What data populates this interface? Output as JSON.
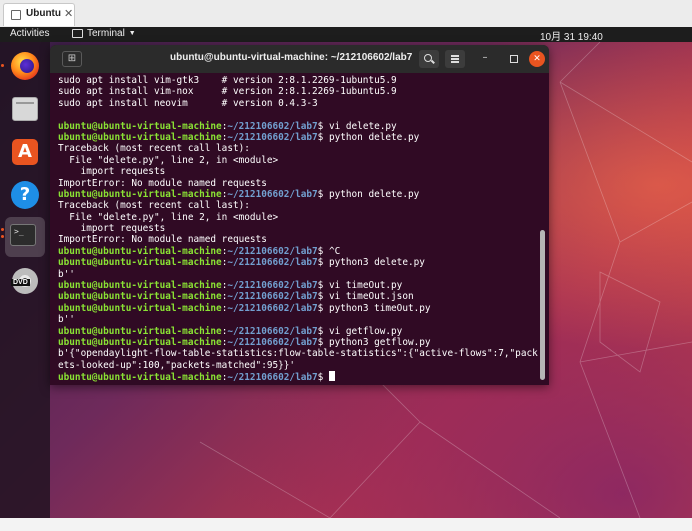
{
  "vm_tab": {
    "label": "Ubuntu",
    "close_glyph": "✕",
    "icon": "vm-screen-icon"
  },
  "topbar": {
    "activities": "Activities",
    "app_name": "Terminal",
    "clock": "10月 31  19:40"
  },
  "dock": {
    "items": [
      {
        "name": "firefox",
        "icon": "firefox-icon"
      },
      {
        "name": "files",
        "icon": "files-icon"
      },
      {
        "name": "software",
        "icon": "software-store-icon",
        "glyph": "A"
      },
      {
        "name": "help",
        "icon": "help-icon",
        "glyph": "?"
      },
      {
        "name": "terminal",
        "icon": "terminal-icon",
        "glyph": ">_"
      },
      {
        "name": "dvd",
        "icon": "dvd-icon",
        "glyph": "DVD"
      }
    ]
  },
  "terminal": {
    "title": "ubuntu@ubuntu-virtual-machine: ~/212106602/lab7",
    "colors": {
      "background": "#300a24",
      "user": "#8ae234",
      "path": "#729fcf",
      "text": "#ffffff"
    },
    "lines": [
      {
        "text": "sudo apt install vim-gtk3    # version 2:8.1.2269-1ubuntu5.9"
      },
      {
        "text": "sudo apt install vim-nox     # version 2:8.1.2269-1ubuntu5.9"
      },
      {
        "text": "sudo apt install neovim      # version 0.4.3-3"
      },
      {
        "text": ""
      },
      {
        "user": "ubuntu@ubuntu-virtual-machine",
        "path": "~/212106602/lab7",
        "cmd": "vi delete.py"
      },
      {
        "user": "ubuntu@ubuntu-virtual-machine",
        "path": "~/212106602/lab7",
        "cmd": "python delete.py"
      },
      {
        "text": "Traceback (most recent call last):"
      },
      {
        "text": "  File \"delete.py\", line 2, in <module>"
      },
      {
        "text": "    import requests"
      },
      {
        "text": "ImportError: No module named requests"
      },
      {
        "user": "ubuntu@ubuntu-virtual-machine",
        "path": "~/212106602/lab7",
        "cmd": "python delete.py"
      },
      {
        "text": "Traceback (most recent call last):"
      },
      {
        "text": "  File \"delete.py\", line 2, in <module>"
      },
      {
        "text": "    import requests"
      },
      {
        "text": "ImportError: No module named requests"
      },
      {
        "user": "ubuntu@ubuntu-virtual-machine",
        "path": "~/212106602/lab7",
        "cmd": "^C"
      },
      {
        "user": "ubuntu@ubuntu-virtual-machine",
        "path": "~/212106602/lab7",
        "cmd": "python3 delete.py"
      },
      {
        "text": "b''"
      },
      {
        "user": "ubuntu@ubuntu-virtual-machine",
        "path": "~/212106602/lab7",
        "cmd": "vi timeOut.py"
      },
      {
        "user": "ubuntu@ubuntu-virtual-machine",
        "path": "~/212106602/lab7",
        "cmd": "vi timeOut.json"
      },
      {
        "user": "ubuntu@ubuntu-virtual-machine",
        "path": "~/212106602/lab7",
        "cmd": "python3 timeOut.py"
      },
      {
        "text": "b''"
      },
      {
        "user": "ubuntu@ubuntu-virtual-machine",
        "path": "~/212106602/lab7",
        "cmd": "vi getflow.py"
      },
      {
        "user": "ubuntu@ubuntu-virtual-machine",
        "path": "~/212106602/lab7",
        "cmd": "python3 getflow.py"
      },
      {
        "text": "b'{\"opendaylight-flow-table-statistics:flow-table-statistics\":{\"active-flows\":7,\"pack"
      },
      {
        "text": "ets-looked-up\":100,\"packets-matched\":95}}'"
      },
      {
        "user": "ubuntu@ubuntu-virtual-machine",
        "path": "~/212106602/lab7",
        "cmd": "",
        "cursor": true
      }
    ]
  }
}
